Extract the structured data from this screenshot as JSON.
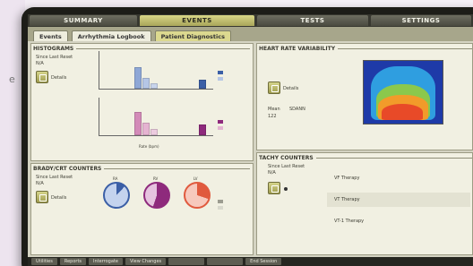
{
  "page_fragment": "e",
  "top_tabs": [
    {
      "label": "SUMMARY",
      "active": false
    },
    {
      "label": "EVENTS",
      "active": true
    },
    {
      "label": "TESTS",
      "active": false
    },
    {
      "label": "SETTINGS",
      "active": false
    }
  ],
  "sub_tabs": [
    {
      "label": "Events",
      "active": false
    },
    {
      "label": "Arrhythmia Logbook",
      "active": false
    },
    {
      "label": "Patient Diagnostics",
      "active": true
    }
  ],
  "histograms": {
    "title": "HISTOGRAMS",
    "since_label": "Since Last Reset",
    "since_value": "N/A",
    "details_label": "Details",
    "xlabel": "Rate (bpm)"
  },
  "brady": {
    "title": "BRADY/CRT COUNTERS",
    "since_label": "Since Last Reset",
    "since_value": "N/A",
    "details_label": "Details",
    "gauges": [
      {
        "value": "RA",
        "color": "#3b5fa6",
        "fill": "#c4d3ee",
        "pct": 0.12
      },
      {
        "value": "RV",
        "color": "#8e2a7c",
        "fill": "#e6c3df",
        "pct": 0.55
      },
      {
        "value": "LV",
        "color": "#e05a3e",
        "fill": "#f7c9bd",
        "pct": 0.3
      }
    ]
  },
  "hrv": {
    "title": "HEART RATE VARIABILITY",
    "details_label": "Details",
    "mean_label": "Mean",
    "mean_value": "122",
    "sdann_label": "SDANN"
  },
  "tachy": {
    "title": "TACHY COUNTERS",
    "since_label": "Since Last Reset",
    "since_value": "N/A",
    "rows": [
      "VF Therapy",
      "VT Therapy",
      "VT-1 Therapy"
    ]
  },
  "bottom_buttons": [
    "Utilities",
    "Reports",
    "Interrogate",
    "View Changes",
    "",
    "",
    "End Session"
  ],
  "colors": {
    "accent": "#d9d787",
    "heat_low": "#1e3aa8",
    "heat_mid": "#2f9ee0",
    "heat_high": "#e84a28"
  }
}
